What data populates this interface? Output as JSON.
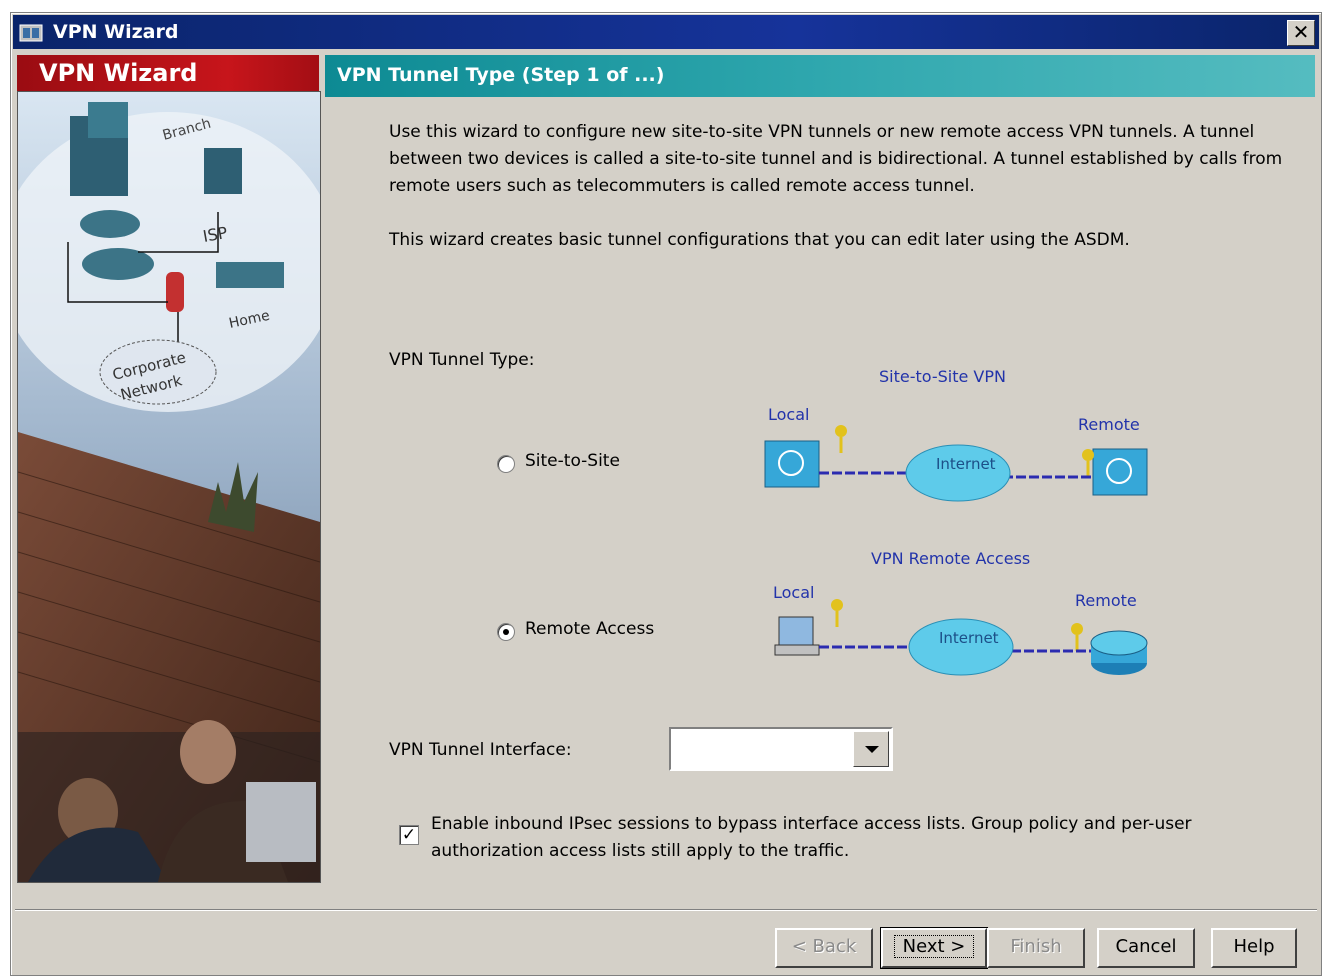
{
  "window": {
    "title": "VPN Wizard",
    "close_glyph": "✕"
  },
  "sidebar": {
    "title": "VPN Wizard",
    "image_labels": {
      "branch": "Branch",
      "isp": "ISP",
      "home": "Home",
      "corporate": "Corporate\nNetwork"
    }
  },
  "main": {
    "heading": "VPN Tunnel Type  (Step 1 of ...)",
    "intro": "Use this wizard to configure new site-to-site VPN tunnels or new remote access VPN tunnels. A tunnel between two devices is called a site-to-site tunnel and is bidirectional. A tunnel established by calls from remote users such as telecommuters is called remote access tunnel.",
    "description": "This wizard creates basic tunnel configurations that you can edit later using the ASDM.",
    "tunnel_type_label": "VPN Tunnel Type:",
    "options": [
      {
        "label": "Site-to-Site",
        "selected": false,
        "diagram": {
          "title": "Site-to-Site VPN",
          "local": "Local",
          "internet": "Internet",
          "remote": "Remote"
        }
      },
      {
        "label": "Remote Access",
        "selected": true,
        "diagram": {
          "title": "VPN Remote Access",
          "local": "Local",
          "internet": "Internet",
          "remote": "Remote"
        }
      }
    ],
    "interface_label": "VPN Tunnel Interface:",
    "interface_value": "",
    "bypass_checkbox": {
      "checked": true,
      "label": "Enable inbound IPsec sessions to bypass interface access lists. Group policy and per-user authorization access lists still apply to the traffic."
    }
  },
  "buttons": {
    "back": "< Back",
    "next": "Next >",
    "finish": "Finish",
    "cancel": "Cancel",
    "help": "Help"
  },
  "colors": {
    "title_bar": "#0a246a",
    "side_header": "#c7151b",
    "main_header": "#2fa7ae",
    "dialog_bg": "#d4d0c8",
    "diagram_text": "#2233aa"
  }
}
